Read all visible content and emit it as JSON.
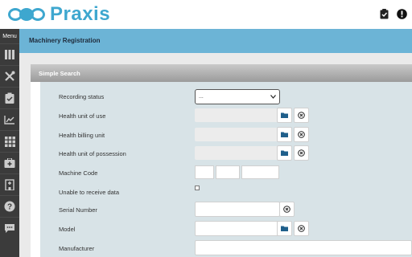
{
  "app": {
    "name": "Praxis"
  },
  "sidebar": {
    "menu_label": "Menu",
    "items": [
      {
        "icon": "books-icon"
      },
      {
        "icon": "tools-icon"
      },
      {
        "icon": "clipboard-check-icon"
      },
      {
        "icon": "chart-line-icon"
      },
      {
        "icon": "grid-icon"
      },
      {
        "icon": "medical-kit-icon"
      },
      {
        "icon": "hospital-icon"
      },
      {
        "icon": "help-icon"
      },
      {
        "icon": "chat-icon"
      }
    ]
  },
  "header": {
    "title": "Machinery Registration"
  },
  "search": {
    "title": "Simple Search",
    "recording_status": {
      "label": "Recording status",
      "value": "..."
    },
    "health_unit_of_use": {
      "label": "Health unit of use"
    },
    "health_billing_unit": {
      "label": "Health billing unit"
    },
    "health_unit_of_possession": {
      "label": "Health unit of possession"
    },
    "machine_code": {
      "label": "Machine Code"
    },
    "unable_to_receive": {
      "label": "Unable to receive data"
    },
    "serial_number": {
      "label": "Serial Number"
    },
    "model": {
      "label": "Model"
    },
    "manufacturer": {
      "label": "Manufacturer"
    }
  },
  "colors": {
    "accent": "#3ea7cf",
    "header": "#6cb4d6",
    "sidebar": "#3b3b3b",
    "panel": "#d8e3e7",
    "folder": "#1f5f8b"
  }
}
